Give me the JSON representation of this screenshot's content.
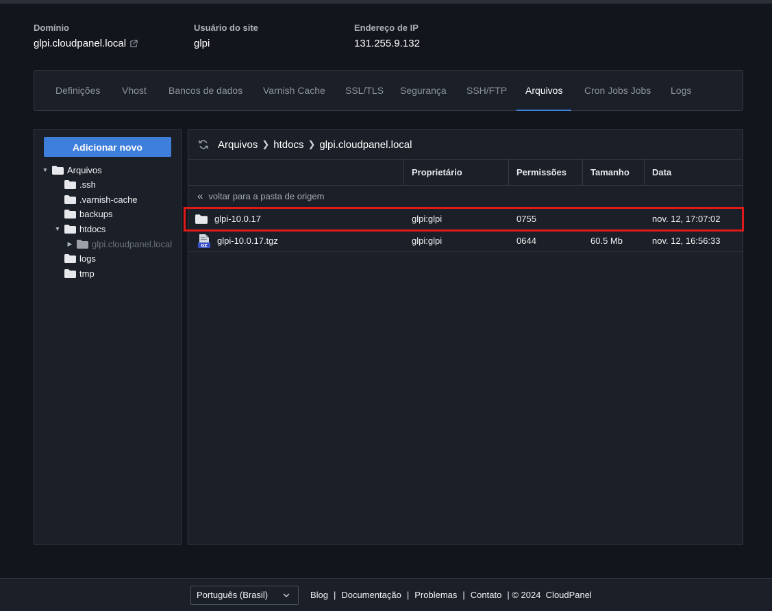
{
  "info": {
    "domain_label": "Domínio",
    "domain_value": "glpi.cloudpanel.local",
    "user_label": "Usuário do site",
    "user_value": "glpi",
    "ip_label": "Endereço de IP",
    "ip_value": "131.255.9.132"
  },
  "tabs": [
    {
      "label": "Definições"
    },
    {
      "label": "Vhost"
    },
    {
      "label": "Bancos de dados"
    },
    {
      "label": "Varnish Cache"
    },
    {
      "label": "SSL/TLS"
    },
    {
      "label": "Segurança"
    },
    {
      "label": "SSH/FTP"
    },
    {
      "label": "Arquivos"
    },
    {
      "label": "Cron Jobs Jobs"
    },
    {
      "label": "Logs"
    }
  ],
  "active_tab": "Arquivos",
  "sidebar": {
    "add_button": "Adicionar novo",
    "tree": [
      {
        "label": "Arquivos"
      },
      {
        "label": ".ssh"
      },
      {
        "label": ".varnish-cache"
      },
      {
        "label": "backups"
      },
      {
        "label": "htdocs"
      },
      {
        "label": "glpi.cloudpanel.local"
      },
      {
        "label": "logs"
      },
      {
        "label": "tmp"
      }
    ]
  },
  "breadcrumb": [
    "Arquivos",
    "htdocs",
    "glpi.cloudpanel.local"
  ],
  "table": {
    "headers": {
      "owner": "Proprietário",
      "permissions": "Permissões",
      "size": "Tamanho",
      "date": "Data"
    },
    "back_label": "voltar para a pasta de origem",
    "rows": [
      {
        "name": "glpi-10.0.17",
        "owner": "glpi:glpi",
        "permissions": "0755",
        "size": "",
        "date": "nov. 12, 17:07:02",
        "type": "folder"
      },
      {
        "name": "glpi-10.0.17.tgz",
        "owner": "glpi:glpi",
        "permissions": "0644",
        "size": "60.5 Mb",
        "date": "nov. 12, 16:56:33",
        "type": "gz-file"
      }
    ]
  },
  "footer": {
    "language": "Português (Brasil)",
    "links": [
      "Blog",
      "Documentação",
      "Problemas",
      "Contato"
    ],
    "copyright": "| © 2024  CloudPanel"
  },
  "colors": {
    "accent": "#3f7fdc",
    "highlight": "#e01a1a",
    "background": "#12151c",
    "panel": "#1b1f27"
  }
}
